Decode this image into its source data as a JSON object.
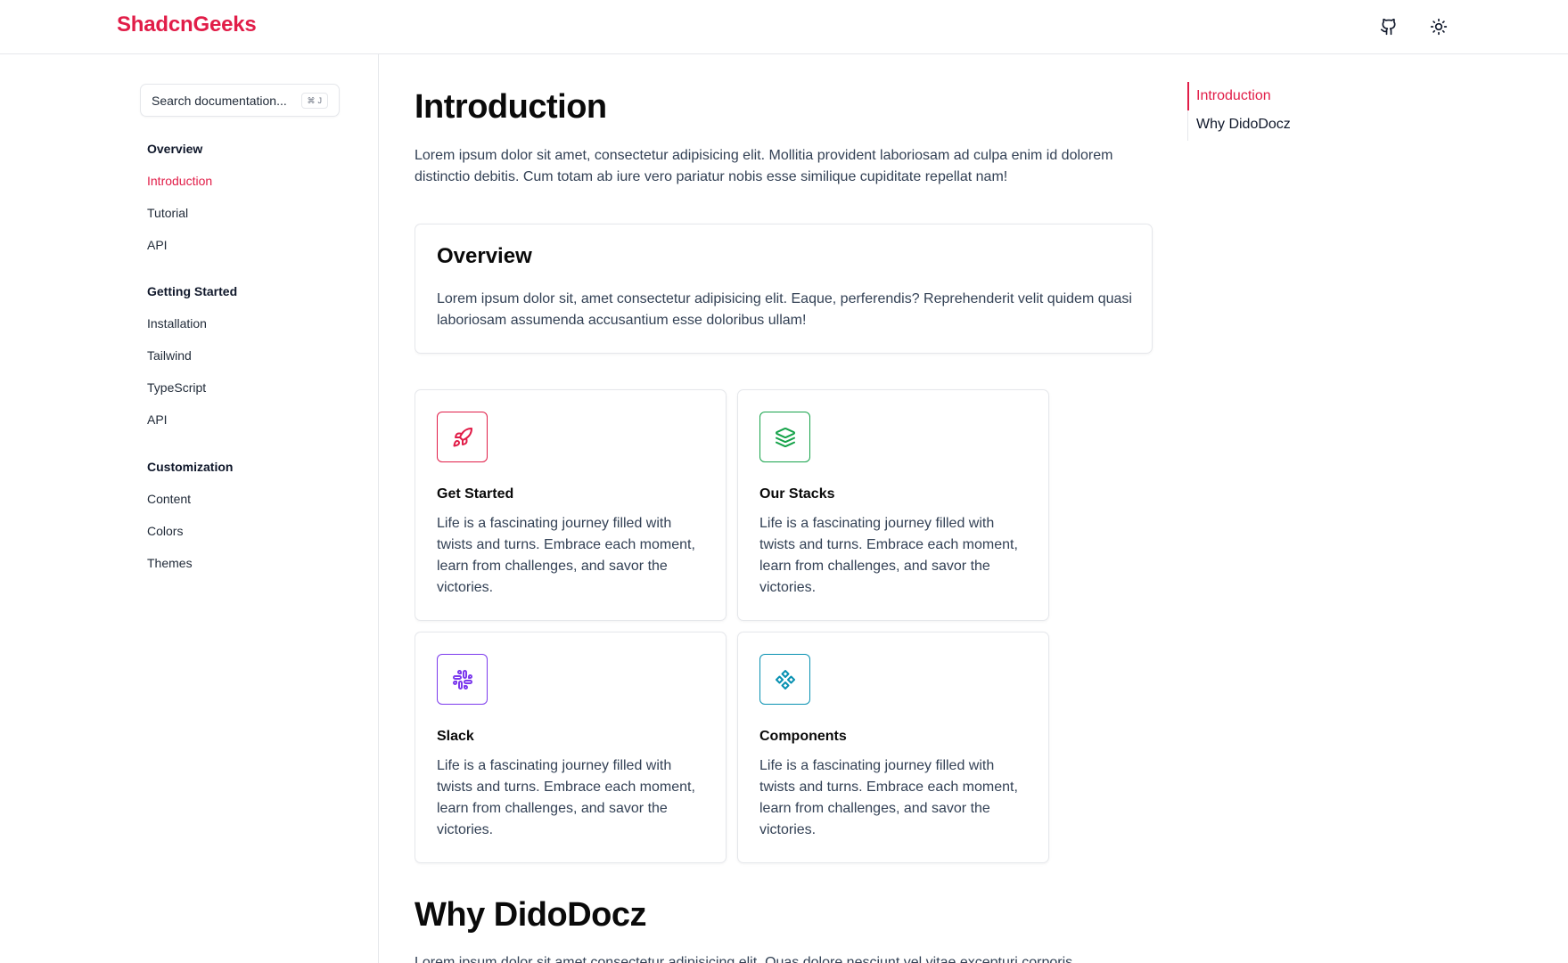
{
  "header": {
    "logo": "ShadcnGeeks",
    "icons": {
      "github": "github-icon",
      "theme": "sun-icon"
    }
  },
  "sidebar": {
    "search": {
      "placeholder": "Search documentation...",
      "shortcut_symbol": "⌘",
      "shortcut_key": "J"
    },
    "sections": [
      {
        "heading": "Overview",
        "items": [
          "Introduction",
          "Tutorial",
          "API"
        ]
      },
      {
        "heading": "Getting Started",
        "items": [
          "Installation",
          "Tailwind",
          "TypeScript",
          "API"
        ]
      },
      {
        "heading": "Customization",
        "items": [
          "Content",
          "Colors",
          "Themes"
        ]
      }
    ],
    "active_item": "Introduction"
  },
  "main": {
    "title": "Introduction",
    "lead": "Lorem ipsum dolor sit amet, consectetur adipisicing elit. Mollitia provident laboriosam ad culpa enim id dolorem distinctio debitis. Cum totam ab iure vero pariatur nobis esse similique cupiditate repellat nam!",
    "overview": {
      "title": "Overview",
      "text": "Lorem ipsum dolor sit, amet consectetur adipisicing elit. Eaque, perferendis? Reprehenderit velit quidem quasi laboriosam assumenda accusantium esse doloribus ullam!"
    },
    "cards": [
      {
        "title": "Get Started",
        "text": "Life is a fascinating journey filled with twists and turns. Embrace each moment, learn from challenges, and savor the victories.",
        "icon": "rocket-icon",
        "color": "#e11d48"
      },
      {
        "title": "Our Stacks",
        "text": "Life is a fascinating journey filled with twists and turns. Embrace each moment, learn from challenges, and savor the victories.",
        "icon": "layers-icon",
        "color": "#16a34a"
      },
      {
        "title": "Slack",
        "text": "Life is a fascinating journey filled with twists and turns. Embrace each moment, learn from challenges, and savor the victories.",
        "icon": "slack-icon",
        "color": "#7c3aed"
      },
      {
        "title": "Components",
        "text": "Life is a fascinating journey filled with twists and turns. Embrace each moment, learn from challenges, and savor the victories.",
        "icon": "component-icon",
        "color": "#0891b2"
      }
    ],
    "section2_title": "Why DidoDocz",
    "section2_text": "Lorem ipsum dolor sit amet consectetur adipisicing elit. Quas dolore nesciunt vel vitae excepturi corporis"
  },
  "toc": {
    "items": [
      "Introduction",
      "Why DidoDocz"
    ],
    "active": "Introduction"
  },
  "colors": {
    "accent": "#e11d48",
    "border": "#e5e7eb",
    "text": "#0f172a",
    "muted_text": "#334155"
  }
}
